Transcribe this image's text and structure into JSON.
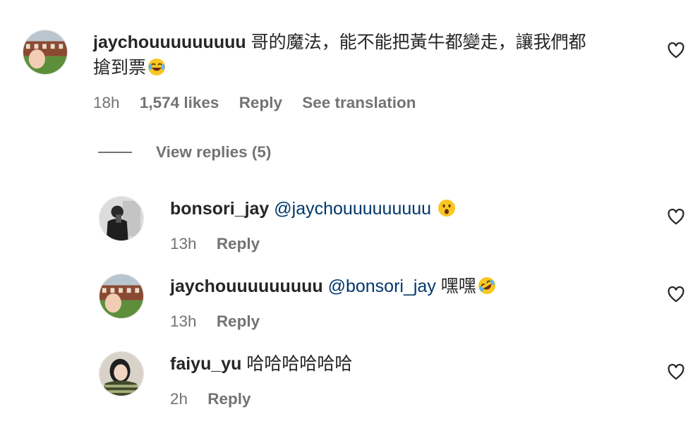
{
  "comment": {
    "username": "jaychouuuuuuuuu",
    "text_line1": "哥的魔法，能不能把黃牛都變走，讓我們都",
    "text_line2": "搶到票",
    "emoji": "face-with-tears-of-joy",
    "time": "18h",
    "likes": "1,574 likes",
    "reply_label": "Reply",
    "translate_label": "See translation"
  },
  "view_replies_label": "View replies (5)",
  "replies": [
    {
      "username": "bonsori_jay",
      "mention": "@jaychouuuuuuuuu",
      "text": "",
      "emoji": "hushed-face",
      "time": "13h",
      "reply_label": "Reply"
    },
    {
      "username": "jaychouuuuuuuuu",
      "mention": "@bonsori_jay",
      "text": "嘿嘿",
      "emoji": "rolling-on-the-floor-laughing",
      "time": "13h",
      "reply_label": "Reply"
    },
    {
      "username": "faiyu_yu",
      "mention": "",
      "text": "哈哈哈哈哈哈",
      "emoji": "",
      "time": "2h",
      "reply_label": "Reply"
    }
  ],
  "colors": {
    "text": "#262626",
    "secondary": "#737373",
    "mention": "#00376b"
  }
}
